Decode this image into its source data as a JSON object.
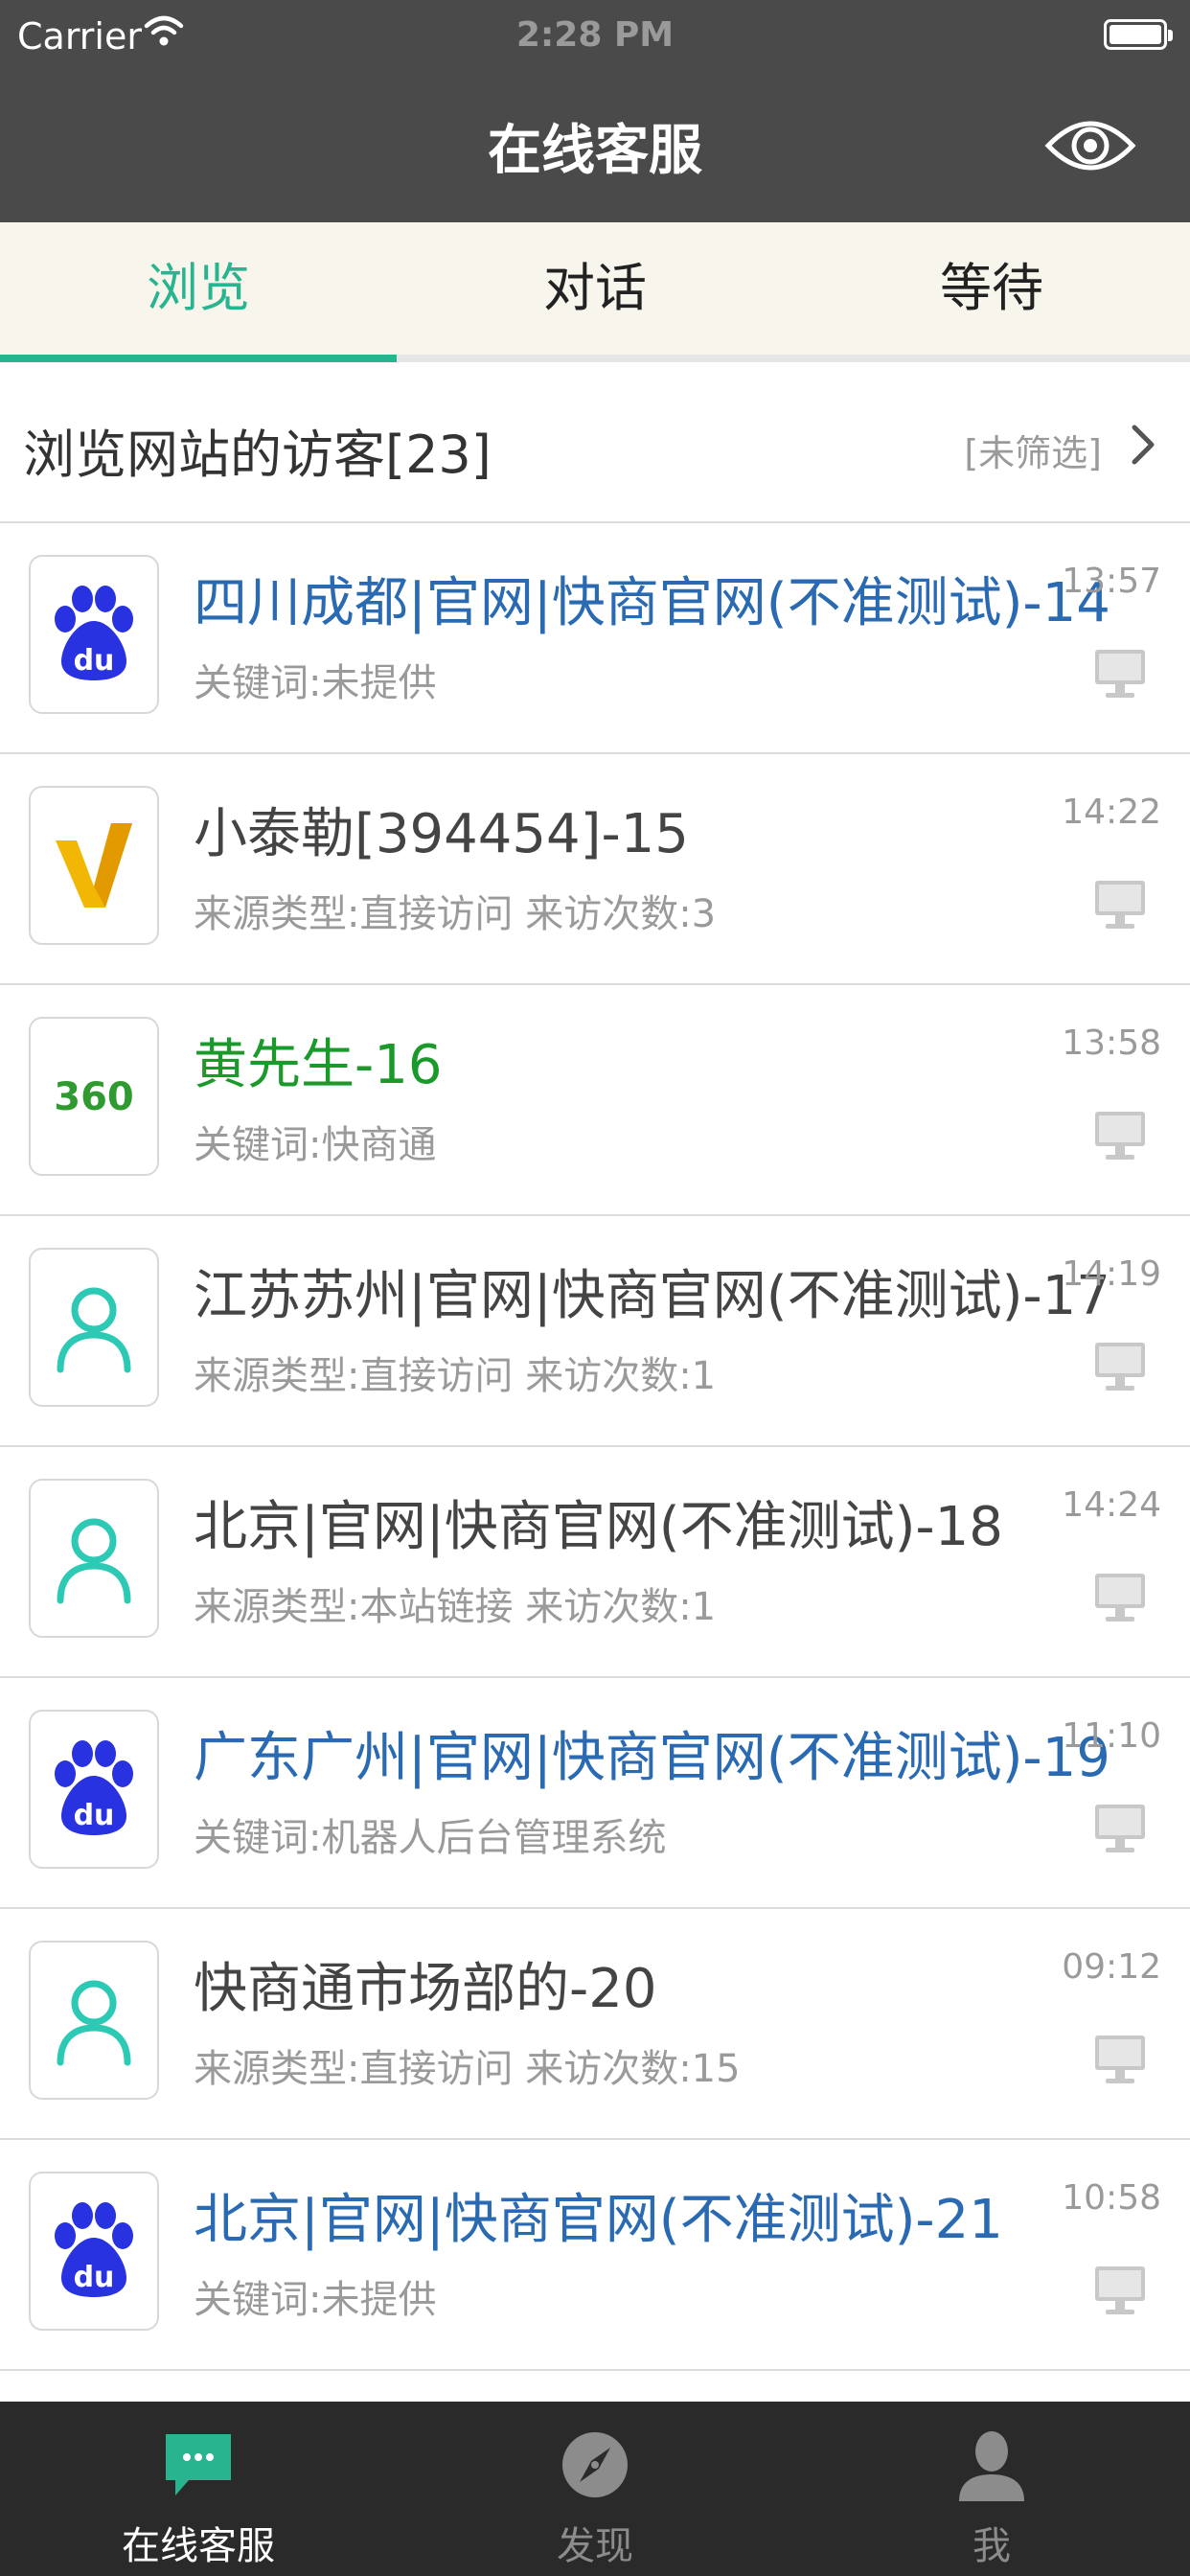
{
  "status_bar": {
    "carrier": "Carrier",
    "time": "2:28 PM"
  },
  "nav": {
    "title": "在线客服"
  },
  "tabs": [
    {
      "label": "浏览",
      "active": true
    },
    {
      "label": "对话",
      "active": false
    },
    {
      "label": "等待",
      "active": false
    }
  ],
  "visitors": {
    "header": "浏览网站的访客[23]",
    "filter": "[未筛选]"
  },
  "rows": [
    {
      "name": "四川成都|官网|快商官网(不准测试)-14",
      "sub": "关键词:未提供",
      "time": "13:57",
      "icon": "baidu-icon",
      "name_color": "#2a6ab3"
    },
    {
      "name": "小泰勒[394454]-15",
      "sub": "来源类型:直接访问 来访次数:3",
      "time": "14:22",
      "icon": "v-logo-icon",
      "name_color": "#444444"
    },
    {
      "name": "黄先生-16",
      "sub": "关键词:快商通",
      "time": "13:58",
      "icon": "360-icon",
      "name_color": "#1a9a2a"
    },
    {
      "name": "江苏苏州|官网|快商官网(不准测试)-17",
      "sub": "来源类型:直接访问 来访次数:1",
      "time": "14:19",
      "icon": "person-icon",
      "name_color": "#444444"
    },
    {
      "name": "北京|官网|快商官网(不准测试)-18",
      "sub": "来源类型:本站链接 来访次数:1",
      "time": "14:24",
      "icon": "person-icon",
      "name_color": "#444444"
    },
    {
      "name": "广东广州|官网|快商官网(不准测试)-19",
      "sub": "关键词:机器人后台管理系统",
      "time": "11:10",
      "icon": "baidu-icon",
      "name_color": "#2a6ab3"
    },
    {
      "name": "快商通市场部的-20",
      "sub": "来源类型:直接访问 来访次数:15",
      "time": "09:12",
      "icon": "person-icon",
      "name_color": "#444444"
    },
    {
      "name": "北京|官网|快商官网(不准测试)-21",
      "sub": "关键词:未提供",
      "time": "10:58",
      "icon": "baidu-icon",
      "name_color": "#2a6ab3"
    }
  ],
  "tabbar": [
    {
      "label": "在线客服",
      "active": true
    },
    {
      "label": "发现",
      "active": false
    },
    {
      "label": "我",
      "active": false
    }
  ],
  "colors": {
    "accent": "#28b48f",
    "nav_bg": "#4a4a4a",
    "tabbar_bg": "#2a2a2a"
  }
}
